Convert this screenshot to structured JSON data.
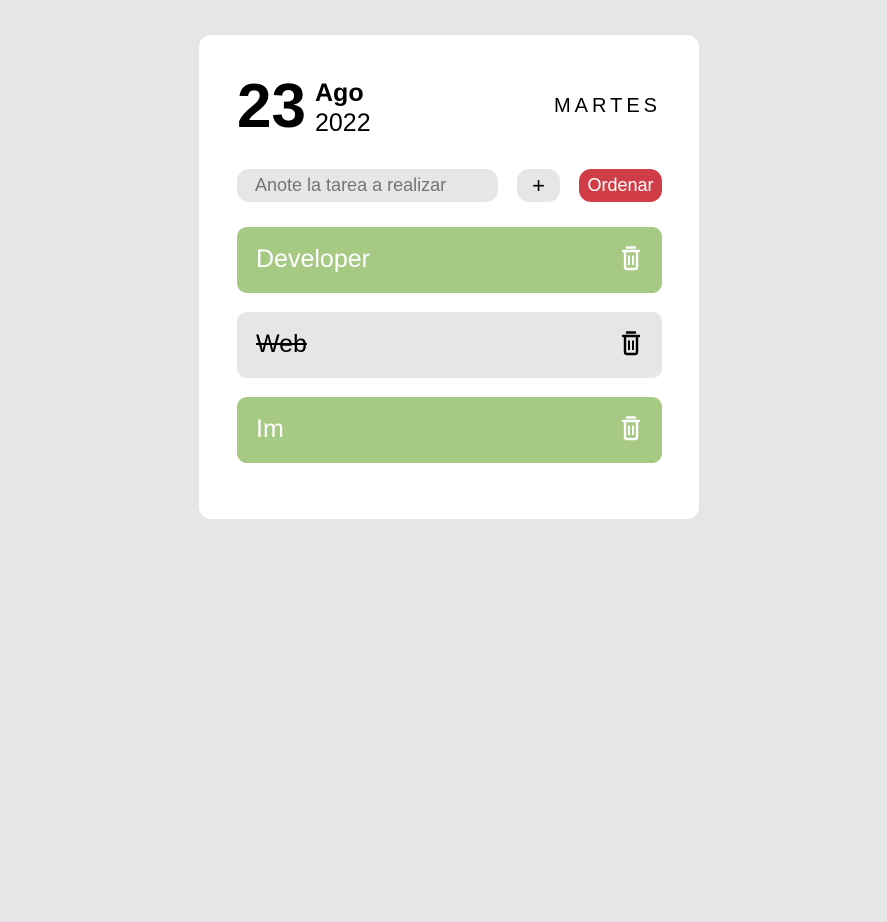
{
  "date": {
    "day": "23",
    "month": "Ago",
    "year": "2022",
    "weekday": "MARTES"
  },
  "form": {
    "input_placeholder": "Anote la tarea a realizar",
    "input_value": "",
    "add_label": "+",
    "sort_label": "Ordenar"
  },
  "tasks": [
    {
      "label": "Developer",
      "done": false
    },
    {
      "label": "Web",
      "done": true
    },
    {
      "label": "Im",
      "done": false
    }
  ],
  "icons": {
    "delete": "trash-icon"
  },
  "colors": {
    "background": "#e6e6e6",
    "card": "#ffffff",
    "pending_task": "#a6c984",
    "done_task": "#e6e6e6",
    "sort_button": "#d13d47"
  }
}
